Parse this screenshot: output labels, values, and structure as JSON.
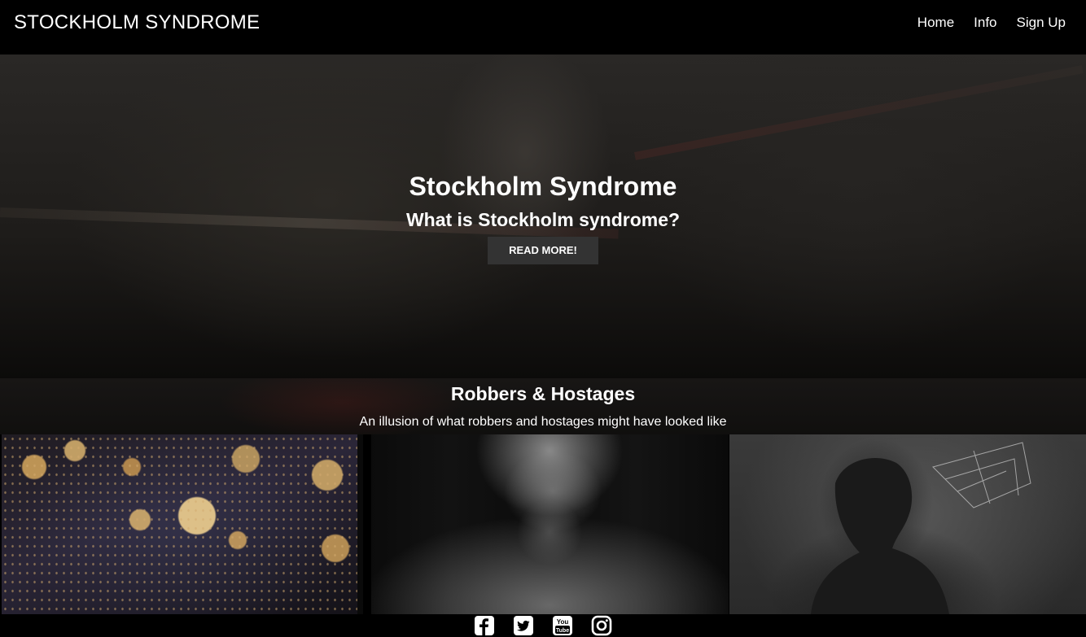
{
  "navbar": {
    "brand": "STOCKHOLM SYNDROME",
    "links": [
      "Home",
      "Info",
      "Sign Up"
    ]
  },
  "hero": {
    "title": "Stockholm Syndrome",
    "subtitle": "What is Stockholm syndrome?",
    "button_label": "READ MORE!"
  },
  "section": {
    "title": "Robbers & Hostages",
    "subtitle": "An illusion of what robbers and hostages might have looked like"
  },
  "gallery": {
    "images": [
      "autumn-leaves-photo",
      "man-portrait-photo",
      "silhouette-photo"
    ]
  },
  "footer": {
    "social_icons": [
      "facebook-icon",
      "twitter-icon",
      "youtube-icon",
      "instagram-icon"
    ]
  },
  "colors": {
    "navbar_bg": "#000000",
    "button_bg": "#333333",
    "text": "#ffffff"
  }
}
